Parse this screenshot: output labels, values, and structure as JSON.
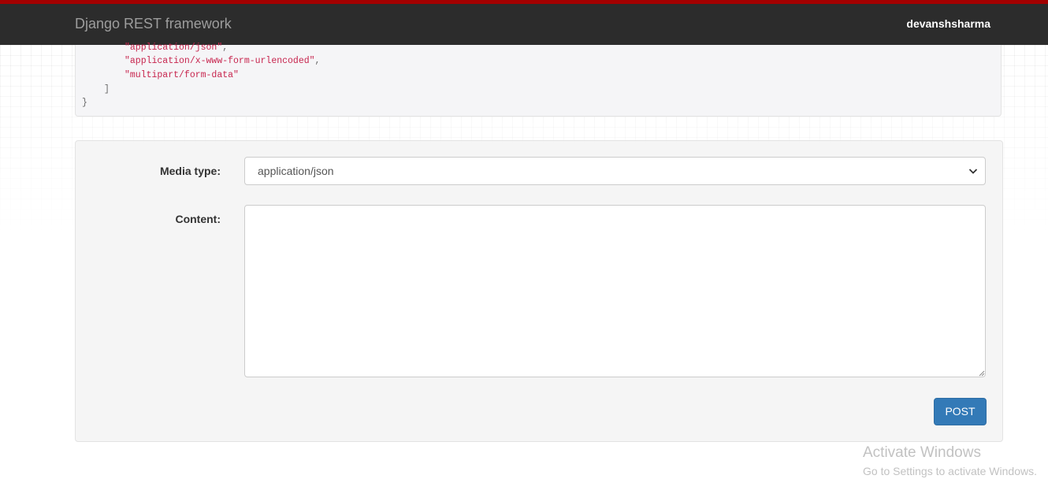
{
  "header": {
    "brand": "Django REST framework",
    "username": "devanshsharma",
    "accent_color": "#a30000",
    "bar_color": "#2c2c2c"
  },
  "response_code": {
    "items": [
      {
        "value": "\"application/json\"",
        "suffix": ","
      },
      {
        "value": "\"application/x-www-form-urlencoded\"",
        "suffix": ","
      },
      {
        "value": "\"multipart/form-data\"",
        "suffix": ""
      }
    ],
    "close_bracket": "]",
    "close_brace": "}"
  },
  "form": {
    "media_type_label": "Media type:",
    "media_type_value": "application/json",
    "content_label": "Content:",
    "content_value": "",
    "submit_label": "POST",
    "submit_color": "#337ab7"
  },
  "watermark": {
    "title": "Activate Windows",
    "subtitle": "Go to Settings to activate Windows."
  }
}
